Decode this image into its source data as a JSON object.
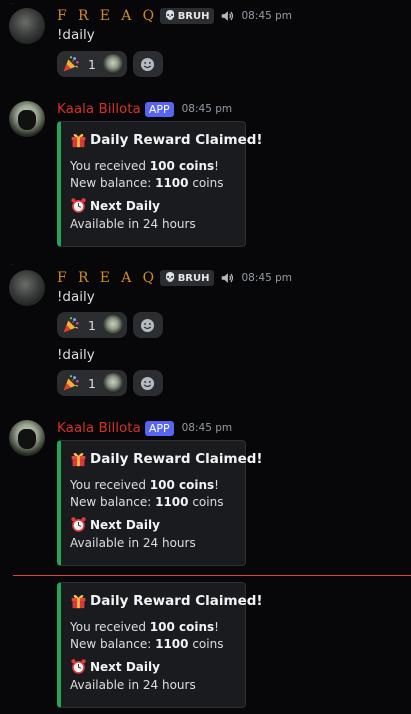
{
  "messages": [
    {
      "author": "F R E A Q",
      "tag": "BRUH",
      "time": "08:45 pm",
      "content": "!daily",
      "reaction": {
        "emoji": "party-popper",
        "count": "1"
      },
      "continuation": null
    },
    {
      "author": "Kaala Billota",
      "badge": "APP",
      "time": "08:45 pm",
      "embed": {
        "title": "Daily Reward Claimed!",
        "received_prefix": "You received ",
        "received_amount": "100 coins",
        "received_suffix": "!",
        "balance_prefix": "New balance: ",
        "balance_amount": "1100",
        "balance_suffix": " coins",
        "field_title": "Next Daily",
        "field_value": "Available in 24 hours"
      }
    },
    {
      "author": "F R E A Q",
      "tag": "BRUH",
      "time": "08:45 pm",
      "content": "!daily",
      "reaction": {
        "emoji": "party-popper",
        "count": "1"
      },
      "continuation": {
        "content": "!daily",
        "reaction": {
          "emoji": "party-popper",
          "count": "1"
        }
      }
    },
    {
      "author": "Kaala Billota",
      "badge": "APP",
      "time": "08:45 pm",
      "embed": {
        "title": "Daily Reward Claimed!",
        "received_prefix": "You received ",
        "received_amount": "100 coins",
        "received_suffix": "!",
        "balance_prefix": "New balance: ",
        "balance_amount": "1100",
        "balance_suffix": " coins",
        "field_title": "Next Daily",
        "field_value": "Available in 24 hours"
      }
    },
    {
      "embed": {
        "title": "Daily Reward Claimed!",
        "received_prefix": "You received ",
        "received_amount": "100 coins",
        "received_suffix": "!",
        "balance_prefix": "New balance: ",
        "balance_amount": "1100",
        "balance_suffix": " coins",
        "field_title": "Next Daily",
        "field_value": "Available in 24 hours"
      }
    }
  ],
  "colors": {
    "freaq_name": "#d18a2b",
    "kaala_name": "#d6302b",
    "app_badge": "#5865f2",
    "embed_accent": "#23a55a",
    "new_divider": "#e2403e"
  },
  "icons": {
    "reaction_emoji": "party-popper",
    "embed_title_emoji": "gift",
    "field_emoji": "alarm-clock",
    "tag_emoji": "skull",
    "status_icon": "speaker-icon",
    "add_reaction": "smiley-add-icon"
  }
}
